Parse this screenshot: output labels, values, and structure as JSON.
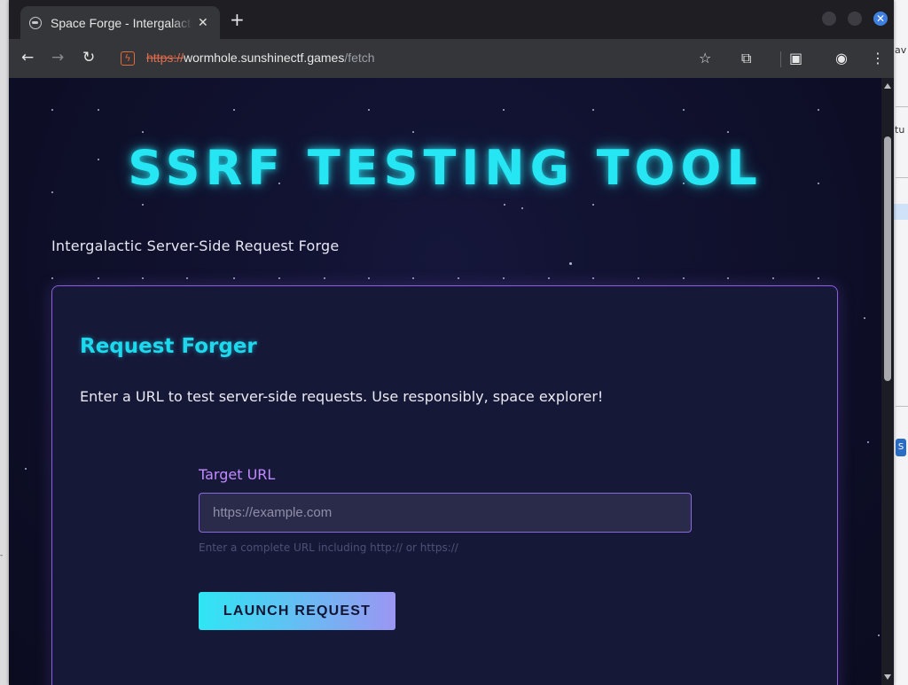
{
  "browser": {
    "tab_title": "Space Forge - Intergalactic SSRF Testing Tool",
    "tab_close": "✕",
    "new_tab": "+",
    "url_scheme": "https://",
    "url_host": "wormhole.sunshinectf.games",
    "url_path": "/fetch"
  },
  "page": {
    "hero_title": "SSRF TESTING TOOL",
    "subtitle": "Intergalactic Server-Side Request Forge",
    "card": {
      "title": "Request Forger",
      "description": "Enter a URL to test server-side requests. Use responsibly, space explorer!",
      "field_label": "Target URL",
      "input_value": "",
      "input_placeholder": "https://example.com",
      "hint": "Enter a complete URL including http:// or https://",
      "button_label": "LAUNCH REQUEST"
    }
  },
  "colors": {
    "accent_cyan": "#25e6f2",
    "accent_purple": "#c28aff",
    "background": "#0d0e26"
  }
}
